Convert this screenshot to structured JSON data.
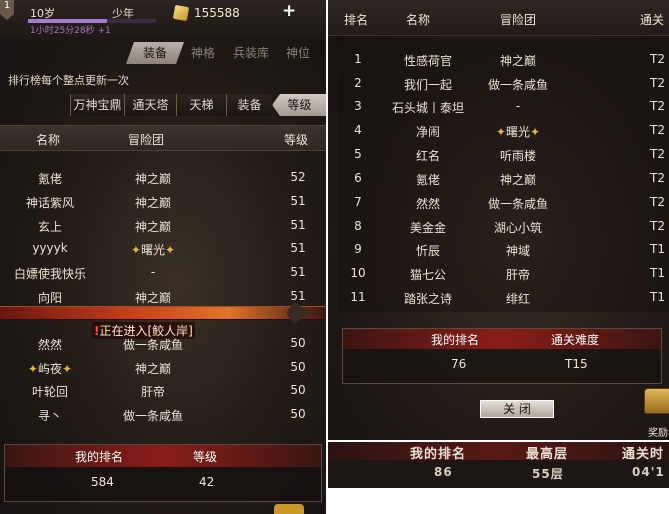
{
  "left_panel": {
    "player": {
      "age": "10岁",
      "title": "少年",
      "playtime": "1小时25分28秒 +1",
      "exp_progress": 0.62,
      "level_badge": "1"
    },
    "currency": {
      "gold": "155588",
      "plus": "+"
    },
    "top_tabs": [
      {
        "label": "装备",
        "active": true
      },
      {
        "label": "神格",
        "active": false
      },
      {
        "label": "兵装库",
        "active": false
      },
      {
        "label": "神位",
        "active": false
      }
    ],
    "notice": "排行榜每个整点更新一次",
    "sub_tabs": [
      {
        "label": "万神宝鼎",
        "active": false
      },
      {
        "label": "通天塔",
        "active": false
      },
      {
        "label": "天梯",
        "active": false
      },
      {
        "label": "装备",
        "active": false
      },
      {
        "label": "等级",
        "active": true
      }
    ],
    "headers": {
      "name": "名称",
      "guild": "冒险团",
      "level": "等级"
    },
    "rows": [
      {
        "name": "氪佬",
        "guild": "神之巅",
        "level": "52"
      },
      {
        "name": "神话紫风",
        "guild": "神之巅",
        "level": "51"
      },
      {
        "name": "玄上",
        "guild": "神之巅",
        "level": "51"
      },
      {
        "name": "yyyyk",
        "guild": "曙光",
        "level": "51"
      },
      {
        "name": "白嫖使我快乐",
        "guild": "-",
        "level": "51"
      },
      {
        "name": "向阳",
        "guild": "神之巅",
        "level": "51"
      },
      {
        "name": "然然",
        "guild": "做一条咸鱼",
        "level": "50"
      },
      {
        "name": "屿夜",
        "guild": "神之巅",
        "level": "50"
      },
      {
        "name": "叶轮回",
        "guild": "肝帝",
        "level": "50"
      },
      {
        "name": "寻丶",
        "guild": "做一条咸鱼",
        "level": "50"
      }
    ],
    "loading_message": {
      "icon": "!",
      "text": "正在进入[鲛人岸]"
    },
    "my_rank": {
      "rank_label": "我的排名",
      "level_label": "等级",
      "rank": "584",
      "level": "42"
    }
  },
  "right_panel": {
    "headers": {
      "rank": "排名",
      "name": "名称",
      "guild": "冒险团",
      "difficulty": "通关"
    },
    "rows": [
      {
        "rank": "1",
        "name": "性感荷官",
        "guild": "神之巅",
        "difficulty": "T2"
      },
      {
        "rank": "2",
        "name": "我们一起",
        "guild": "做一条咸鱼",
        "difficulty": "T2"
      },
      {
        "rank": "3",
        "name": "石头城丨泰坦",
        "guild": "-",
        "difficulty": "T2"
      },
      {
        "rank": "4",
        "name": "净闹",
        "guild": "曙光",
        "difficulty": "T2"
      },
      {
        "rank": "5",
        "name": "红名",
        "guild": "听雨楼",
        "difficulty": "T2"
      },
      {
        "rank": "6",
        "name": "氪佬",
        "guild": "神之巅",
        "difficulty": "T2"
      },
      {
        "rank": "7",
        "name": "然然",
        "guild": "做一条咸鱼",
        "difficulty": "T2"
      },
      {
        "rank": "8",
        "name": "美金金",
        "guild": "湖心小筑",
        "difficulty": "T2"
      },
      {
        "rank": "9",
        "name": "忻辰",
        "guild": "神域",
        "difficulty": "T1"
      },
      {
        "rank": "10",
        "name": "猫七公",
        "guild": "肝帝",
        "difficulty": "T1"
      },
      {
        "rank": "11",
        "name": "踏张之诗",
        "guild": "绯红",
        "difficulty": "T1"
      }
    ],
    "my_rank": {
      "rank_label": "我的排名",
      "difficulty_label": "通关难度",
      "rank": "76",
      "difficulty": "T15"
    },
    "close_button": "关 闭",
    "reward_label": "奖励"
  },
  "bottom_strip": {
    "labels": {
      "rank": "我的排名",
      "floor": "最高层",
      "time": "通关时"
    },
    "values": {
      "rank": "86",
      "floor": "55层",
      "time": "04'1"
    }
  }
}
